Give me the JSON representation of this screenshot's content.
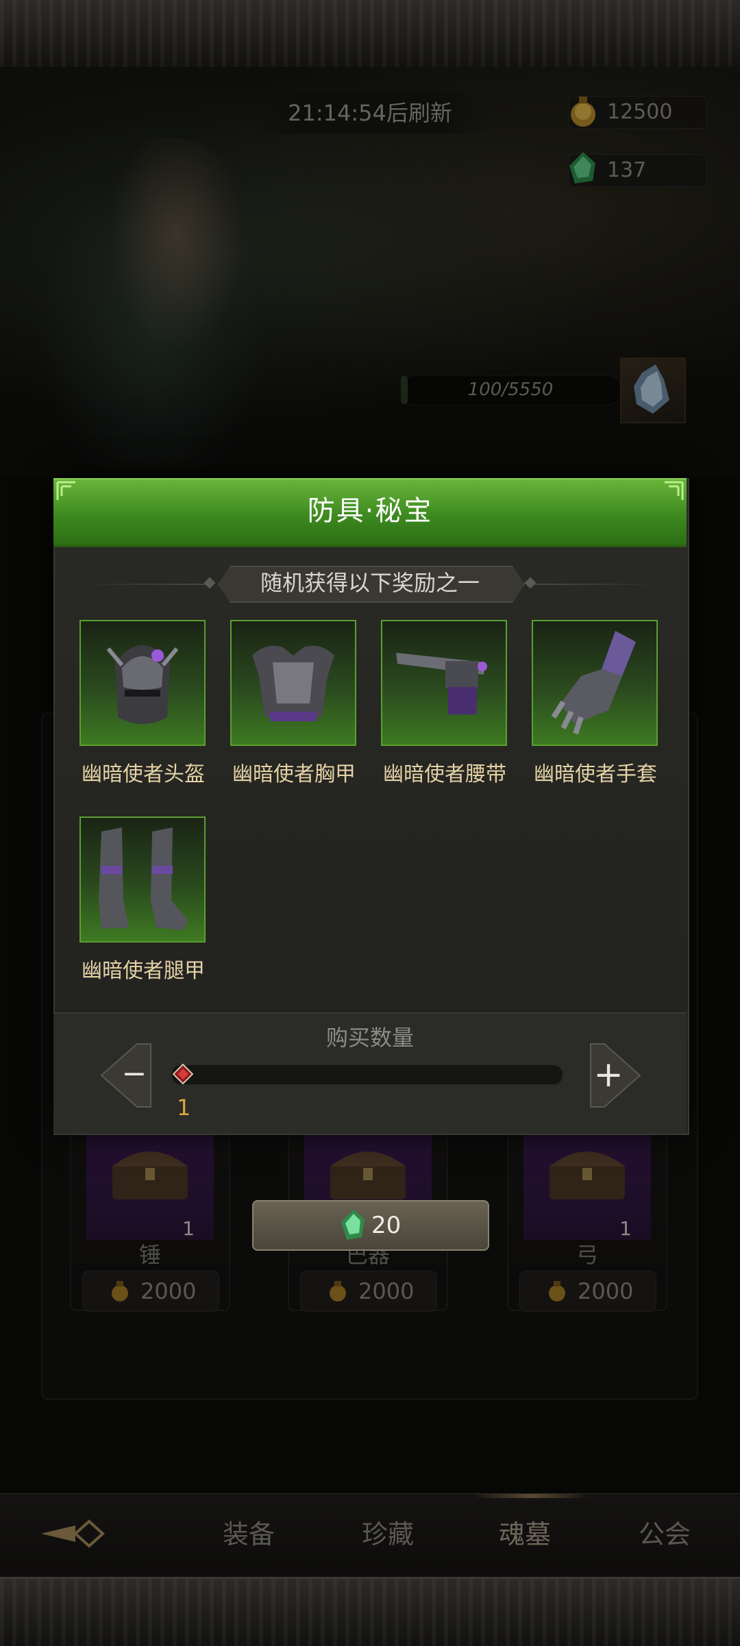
{
  "header": {
    "refresh_timer": "21:14:54后刷新",
    "gold": "12500",
    "gems": "137"
  },
  "progress": {
    "text": "100/5550",
    "fraction": 0.018
  },
  "modal": {
    "title": "防具·秘宝",
    "subtitle": "随机获得以下奖励之一",
    "items": [
      {
        "name": "幽暗使者头盔",
        "icon": "helmet-icon"
      },
      {
        "name": "幽暗使者胸甲",
        "icon": "chest-armor-icon"
      },
      {
        "name": "幽暗使者腰带",
        "icon": "belt-icon"
      },
      {
        "name": "幽暗使者手套",
        "icon": "gauntlet-icon"
      },
      {
        "name": "幽暗使者腿甲",
        "icon": "greaves-icon"
      }
    ],
    "quantity_label": "购买数量",
    "minus": "−",
    "plus": "+",
    "quantity_value": "1"
  },
  "shop": {
    "cards": [
      {
        "name": "锤",
        "count": "1",
        "price": "2000"
      },
      {
        "name": "巴器",
        "count": "",
        "price": "2000"
      },
      {
        "name": "弓",
        "count": "1",
        "price": "2000"
      }
    ],
    "buy_cost": "20"
  },
  "nav": {
    "tabs": [
      "装备",
      "珍藏",
      "魂墓",
      "公会"
    ],
    "active": "魂墓"
  },
  "colors": {
    "accent_green": "#4a9a28",
    "item_name": "#e5d2a6",
    "quantity_gold": "#d7a93a"
  }
}
